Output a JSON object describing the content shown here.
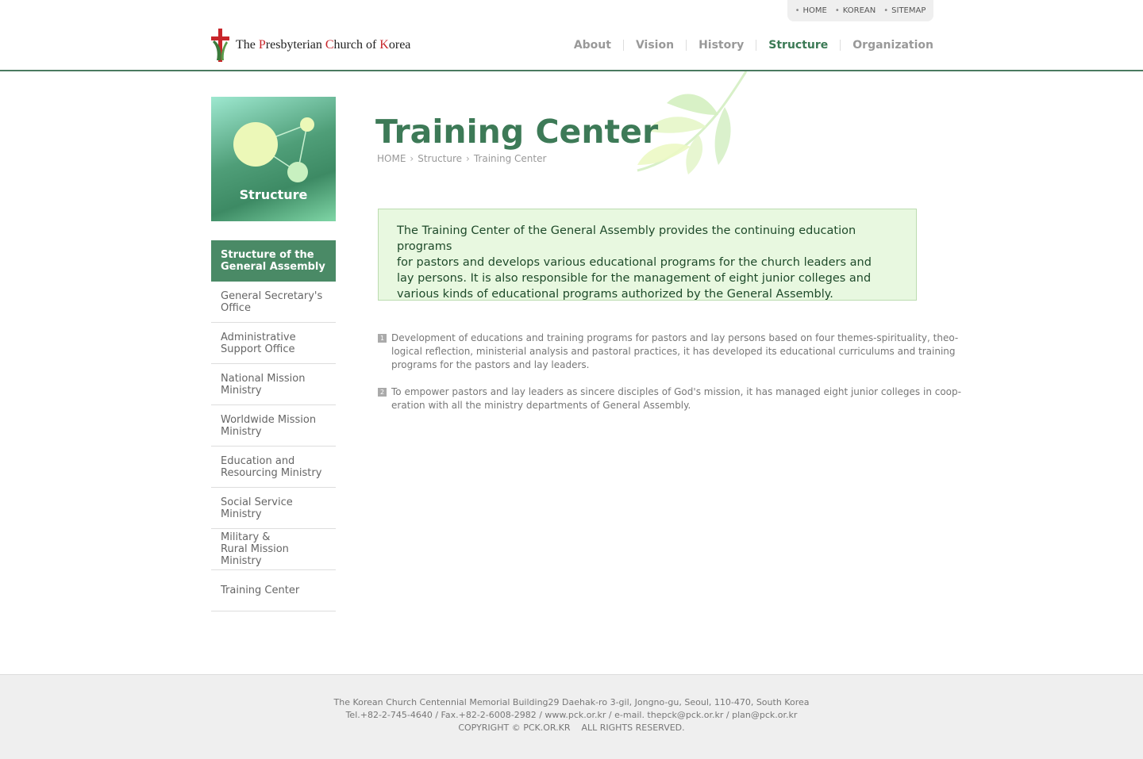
{
  "util_nav": [
    "HOME",
    "KOREAN",
    "SITEMAP"
  ],
  "logo": {
    "prefix": "The ",
    "p": "P",
    "resbyterian": "resbyterian ",
    "c": "C",
    "hurch": "hurch of ",
    "k": "K",
    "orea": "orea"
  },
  "gnb": [
    {
      "label": "About"
    },
    {
      "label": "Vision"
    },
    {
      "label": "History"
    },
    {
      "label": "Structure",
      "active": true
    },
    {
      "label": "Organization"
    }
  ],
  "side_title": "Structure",
  "side_menu": [
    {
      "label": "Structure of the\nGeneral Assembly",
      "active": true
    },
    {
      "label": "General Secretary's\nOffice"
    },
    {
      "label": "Administrative\nSupport Office"
    },
    {
      "label": "National Mission\nMinistry"
    },
    {
      "label": "Worldwide Mission\nMinistry"
    },
    {
      "label": "Education and\nResourcing Ministry"
    },
    {
      "label": "Social Service Ministry"
    },
    {
      "label": "Military &\nRural Mission Ministry"
    },
    {
      "label": "Training Center"
    }
  ],
  "page_title": "Training Center",
  "breadcrumb": [
    "HOME",
    "Structure",
    "Training Center"
  ],
  "breadcrumb_sep": "›",
  "intro_lines": [
    "The Training Center of the General Assembly provides the continuing education programs",
    "for pastors and develops various educational programs for the church leaders and",
    "lay persons. It is also responsible for the management of eight junior colleges and",
    "various kinds of educational programs authorized by the General Assembly."
  ],
  "items": [
    {
      "num": "1",
      "lines": [
        "Development of educations and training programs for pastors and lay persons based on four themes-spirituality, theo-",
        "logical reflection, ministerial analysis and pastoral practices, it has developed its educational curriculums and training",
        "programs for the pastors and lay leaders."
      ]
    },
    {
      "num": "2",
      "lines": [
        "To empower pastors and lay leaders as sincere disciples of God's mission, it has managed eight junior colleges in coop-",
        "eration with all the ministry departments of General Assembly."
      ]
    }
  ],
  "footer": {
    "address": "The Korean Church Centennial Memorial Building29 Daehak-ro 3-gil, Jongno-gu, Seoul, 110-470, South Korea",
    "contact": "Tel.+82-2-745-4640 / Fax.+82-2-6008-2982 / www.pck.or.kr / e-mail. thepck@pck.or.kr / plan@pck.or.kr",
    "copyright": "COPYRIGHT © PCK.OR.KR    ALL RIGHTS RESERVED."
  }
}
